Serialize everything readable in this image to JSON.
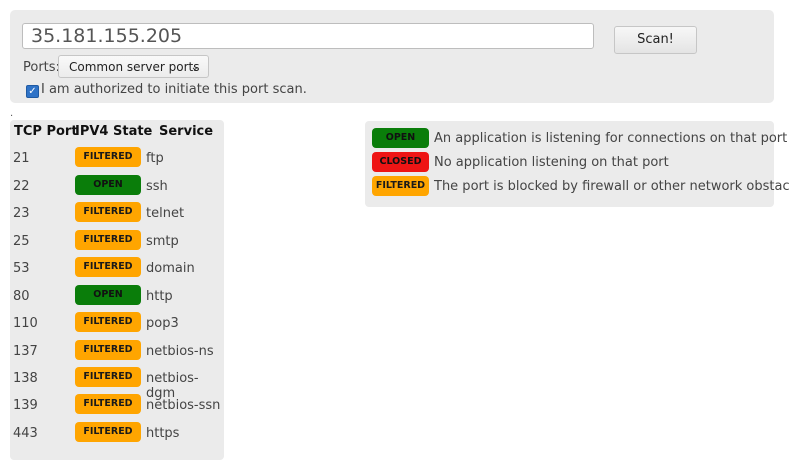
{
  "scan_form": {
    "ip_value": "35.181.155.205",
    "scan_label": "Scan!",
    "ports_label": "Ports:",
    "ports_selected": "Common server ports",
    "auth_label": "I am authorized to initiate this port scan.",
    "auth_checked": true
  },
  "divider_mark": ".",
  "results": {
    "headers": {
      "port": "TCP Port",
      "state": "IPV4 State",
      "service": "Service"
    },
    "rows": [
      {
        "port": "21",
        "state": "FILTERED",
        "service": "ftp"
      },
      {
        "port": "22",
        "state": "OPEN",
        "service": "ssh"
      },
      {
        "port": "23",
        "state": "FILTERED",
        "service": "telnet"
      },
      {
        "port": "25",
        "state": "FILTERED",
        "service": "smtp"
      },
      {
        "port": "53",
        "state": "FILTERED",
        "service": "domain"
      },
      {
        "port": "80",
        "state": "OPEN",
        "service": "http"
      },
      {
        "port": "110",
        "state": "FILTERED",
        "service": "pop3"
      },
      {
        "port": "137",
        "state": "FILTERED",
        "service": "netbios-ns"
      },
      {
        "port": "138",
        "state": "FILTERED",
        "service": "netbios-dgm"
      },
      {
        "port": "139",
        "state": "FILTERED",
        "service": "netbios-ssn"
      },
      {
        "port": "443",
        "state": "FILTERED",
        "service": "https"
      }
    ]
  },
  "legend": [
    {
      "state": "OPEN",
      "description": "An application is listening for connections on that port"
    },
    {
      "state": "CLOSED",
      "description": "No application listening on that port"
    },
    {
      "state": "FILTERED",
      "description": "The port is blocked by firewall or other network obstacle"
    }
  ],
  "colors": {
    "open": "#0a7d0a",
    "closed": "#ee1515",
    "filtered": "#ffa500"
  }
}
